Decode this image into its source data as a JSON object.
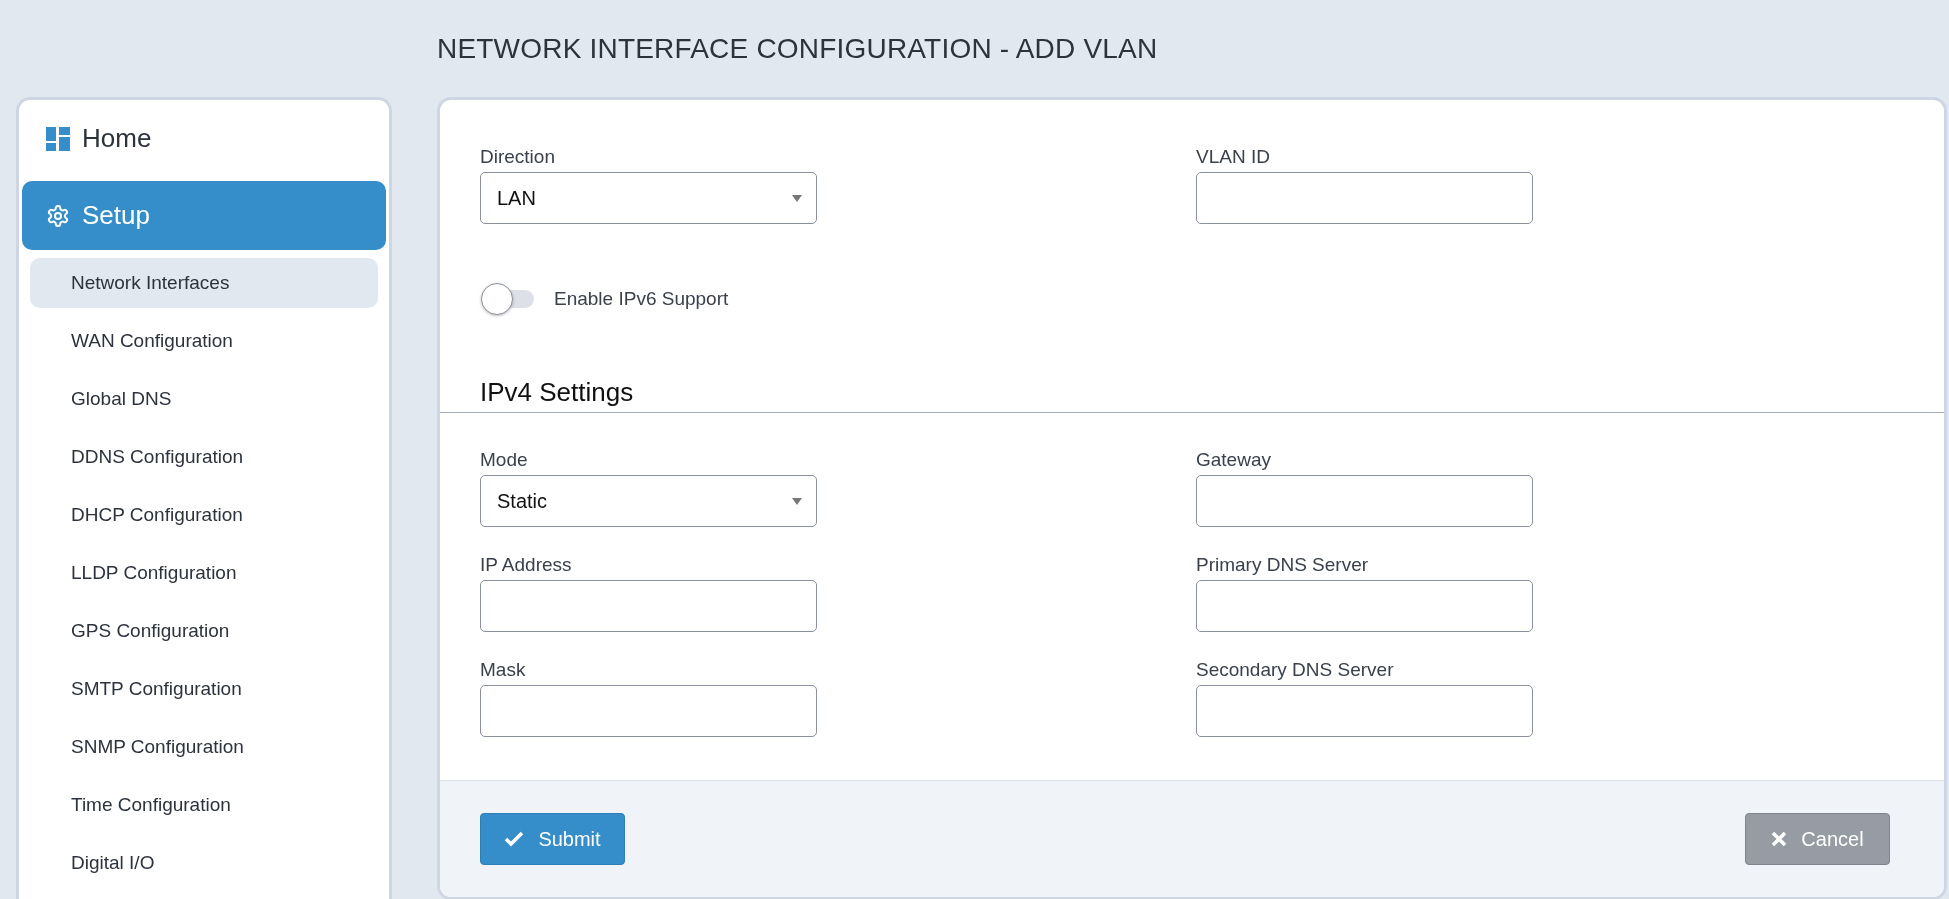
{
  "page_title": "NETWORK INTERFACE CONFIGURATION - ADD VLAN",
  "sidebar": {
    "items": [
      {
        "kind": "top",
        "label": "Home",
        "selected": false
      },
      {
        "kind": "top",
        "label": "Setup",
        "selected": true
      },
      {
        "kind": "sub",
        "label": "Network Interfaces",
        "selected": true
      },
      {
        "kind": "sub",
        "label": "WAN Configuration",
        "selected": false
      },
      {
        "kind": "sub",
        "label": "Global DNS",
        "selected": false
      },
      {
        "kind": "sub",
        "label": "DDNS Configuration",
        "selected": false
      },
      {
        "kind": "sub",
        "label": "DHCP Configuration",
        "selected": false
      },
      {
        "kind": "sub",
        "label": "LLDP Configuration",
        "selected": false
      },
      {
        "kind": "sub",
        "label": "GPS Configuration",
        "selected": false
      },
      {
        "kind": "sub",
        "label": "SMTP Configuration",
        "selected": false
      },
      {
        "kind": "sub",
        "label": "SNMP Configuration",
        "selected": false
      },
      {
        "kind": "sub",
        "label": "Time Configuration",
        "selected": false
      },
      {
        "kind": "sub",
        "label": "Digital I/O",
        "selected": false
      }
    ]
  },
  "form": {
    "top_fields": [
      {
        "kind": "select",
        "label": "Direction",
        "value": "LAN"
      },
      {
        "kind": "text",
        "label": "VLAN ID"
      }
    ],
    "ipv6_toggle": {
      "label": "Enable IPv6 Support",
      "on": false
    },
    "ipv4_section": {
      "heading": "IPv4 Settings",
      "left_fields": [
        {
          "kind": "select",
          "label": "Mode",
          "value": "Static"
        },
        {
          "kind": "text",
          "label": "IP Address"
        },
        {
          "kind": "text",
          "label": "Mask"
        }
      ],
      "right_fields": [
        {
          "kind": "text",
          "label": "Gateway"
        },
        {
          "kind": "text",
          "label": "Primary DNS Server"
        },
        {
          "kind": "text",
          "label": "Secondary DNS Server"
        }
      ]
    }
  },
  "footer": {
    "buttons": [
      {
        "kind": "primary",
        "label": "Submit"
      },
      {
        "kind": "secondary",
        "label": "Cancel"
      }
    ]
  }
}
